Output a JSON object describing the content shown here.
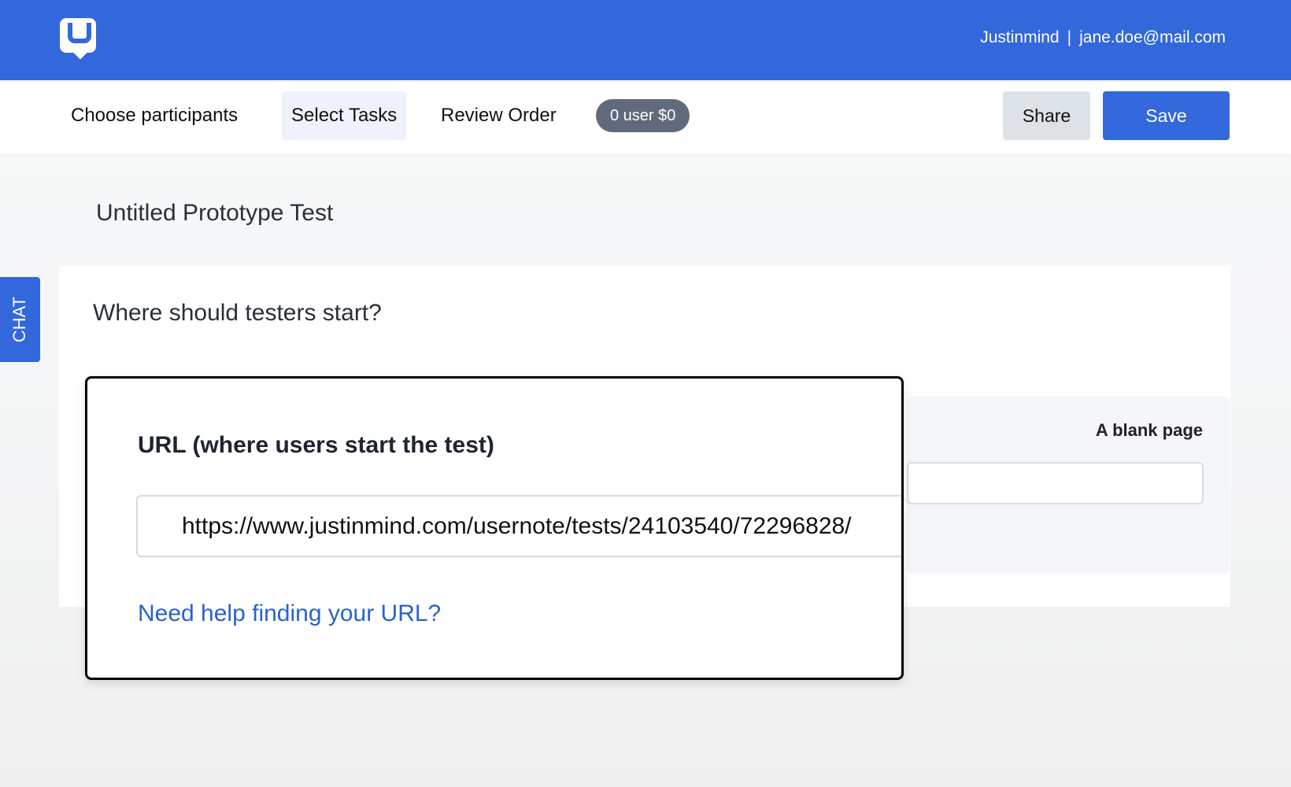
{
  "header": {
    "account_name": "Justinmind",
    "separator": "|",
    "email": "jane.doe@mail.com"
  },
  "tabs": [
    {
      "label": "Choose participants",
      "active": false
    },
    {
      "label": "Select Tasks",
      "active": true
    },
    {
      "label": "Review Order",
      "active": false
    }
  ],
  "summary_badge": "0 user $0",
  "actions": {
    "share_label": "Share",
    "save_label": "Save"
  },
  "chat_tab_label": "CHAT",
  "page_title": "Untitled Prototype Test",
  "card": {
    "question": "Where should testers start?",
    "option_label": "A blank page"
  },
  "popover": {
    "field_label": "URL (where users start the test)",
    "url_value": "https://www.justinmind.com/usernote/tests/24103540/72296828/",
    "help_link": "Need help finding your URL?"
  },
  "colors": {
    "brand_blue": "#3367dc",
    "badge_gray": "#616a7b",
    "link_blue": "#2a62c9"
  }
}
